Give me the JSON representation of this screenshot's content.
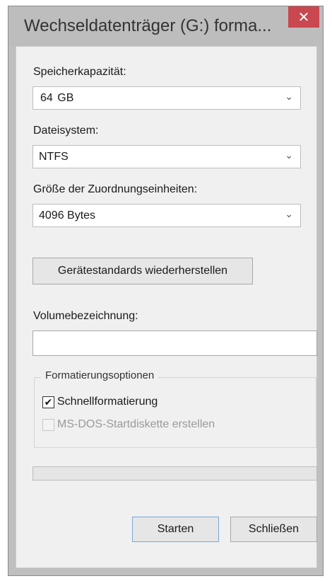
{
  "window": {
    "title": "Wechseldatenträger (G:) forma...",
    "close_glyph": "✕"
  },
  "capacity": {
    "label": "Speicherkapazität:",
    "value_number": "64",
    "value_unit": "GB"
  },
  "filesystem": {
    "label": "Dateisystem:",
    "value": "NTFS"
  },
  "allocation": {
    "label": "Größe der Zuordnungseinheiten:",
    "value": "4096 Bytes"
  },
  "restore_defaults_label": "Gerätestandards wiederherstellen",
  "volume_label": {
    "label": "Volumebezeichnung:",
    "value": ""
  },
  "format_options": {
    "title": "Formatierungsoptionen",
    "quick_format": {
      "label": "Schnellformatierung",
      "checked": true
    },
    "msdos_boot": {
      "label": "MS-DOS-Startdiskette erstellen",
      "checked": false,
      "disabled": true
    }
  },
  "progress": {
    "value": 0
  },
  "buttons": {
    "start": "Starten",
    "close": "Schließen"
  },
  "icons": {
    "chevron": "⌄",
    "check": "✔"
  },
  "colors": {
    "close_button": "#c9474f",
    "titlebar": "#bdbdbd",
    "client_bg": "#f0f0f0"
  }
}
